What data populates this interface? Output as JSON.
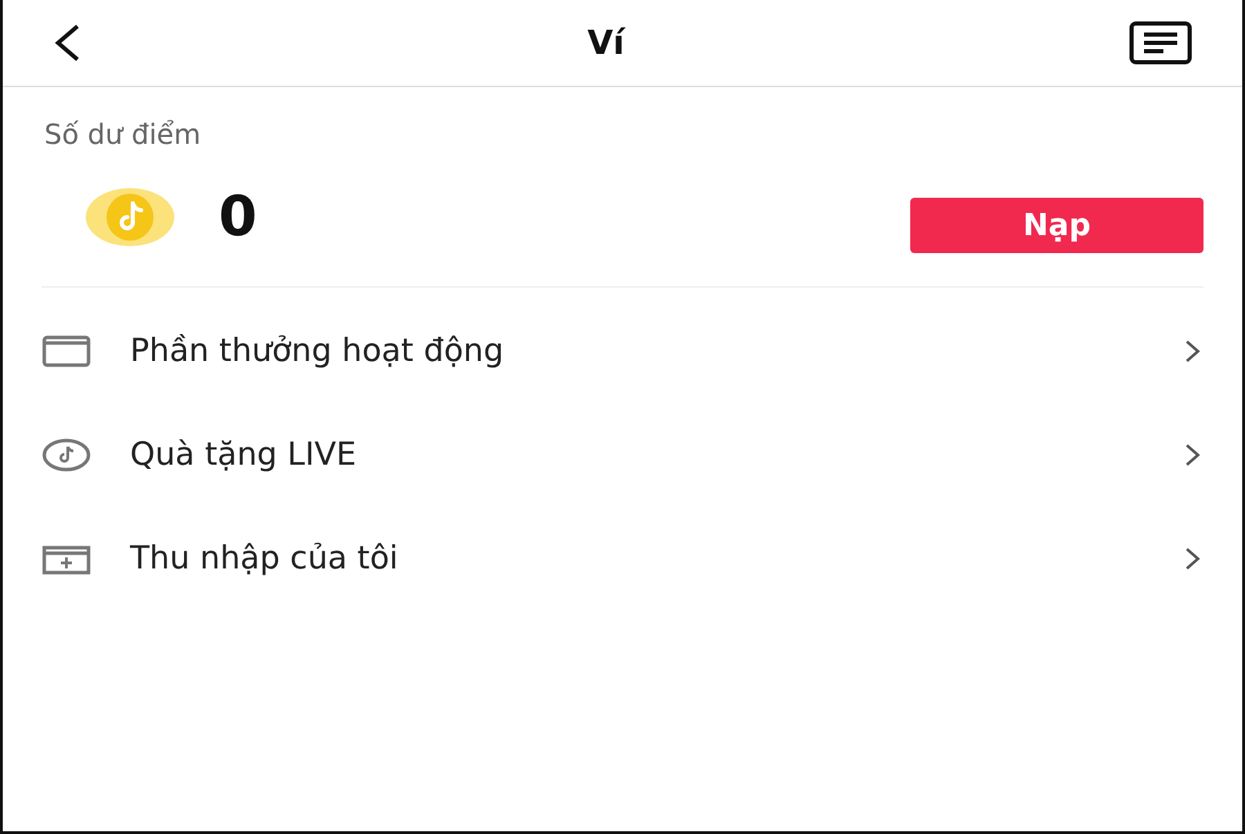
{
  "header": {
    "title": "Ví"
  },
  "balance": {
    "label": "Số dư điểm",
    "amount": "0",
    "button": "Nạp"
  },
  "menu": [
    {
      "kind": "envelope",
      "label": "Phần thưởng hoạt động"
    },
    {
      "kind": "coin",
      "label": "Quà tặng LIVE"
    },
    {
      "kind": "wallet",
      "label": "Thu nhập của tôi"
    }
  ]
}
